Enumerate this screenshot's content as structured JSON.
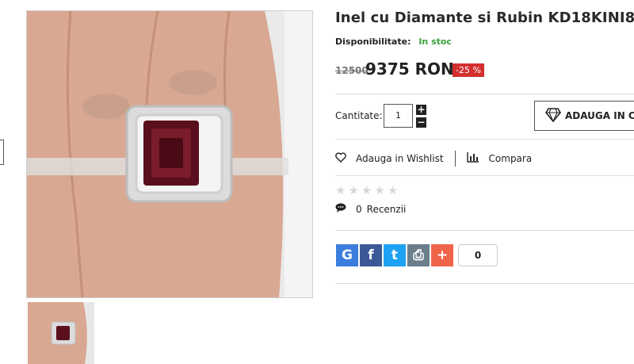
{
  "product": {
    "title": "Inel cu Diamante si Rubin KD18KINI8",
    "availability_label": "Disponibilitate:",
    "availability_value": "In stoc",
    "availability_color": "#3aa33a",
    "old_price": "12500",
    "new_price": "9375 RON",
    "discount": "-25 %",
    "discount_color": "#d32f2f"
  },
  "purchase": {
    "quantity_label": "Cantitate:",
    "quantity_value": "1",
    "plus": "+",
    "minus": "−",
    "add_to_cart": "ADAUGA IN COS"
  },
  "actions": {
    "wishlist": "Adauga in Wishlist",
    "compare": "Compara"
  },
  "rating": {
    "stars_filled": 0,
    "stars_total": 5,
    "review_count": "0",
    "reviews_label": "Recenzii"
  },
  "share": {
    "buttons": [
      {
        "icon": "google-icon",
        "glyph": "G",
        "color": "#3b7ddd"
      },
      {
        "icon": "facebook-icon",
        "glyph": "f",
        "color": "#3b5998"
      },
      {
        "icon": "twitter-icon",
        "glyph": "t",
        "color": "#1da1f2"
      },
      {
        "icon": "print-icon",
        "glyph": "⎙",
        "color": "#6b7e8c"
      },
      {
        "icon": "plus-share-icon",
        "glyph": "+",
        "color": "#f0644a"
      }
    ],
    "count": "0"
  }
}
